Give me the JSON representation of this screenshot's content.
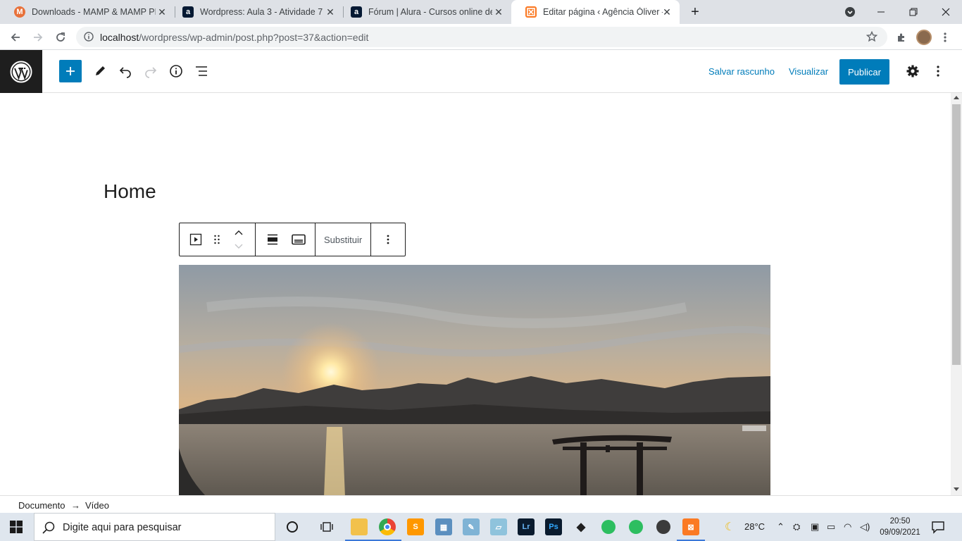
{
  "browser": {
    "tabs": [
      {
        "title": "Downloads - MAMP & MAMP PR",
        "favicon": "mamp-icon",
        "color": "#e8713a",
        "glyph": "M"
      },
      {
        "title": "Wordpress: Aula 3 - Atividade 7",
        "favicon": "alura-icon",
        "color": "#051933",
        "glyph": "a"
      },
      {
        "title": "Fórum | Alura - Cursos online de",
        "favicon": "alura-icon",
        "color": "#051933",
        "glyph": "a"
      },
      {
        "title": "Editar página ‹ Agência Óliver —",
        "favicon": "xampp-icon",
        "color": "#fb7a24",
        "glyph": "⊠"
      }
    ],
    "active_tab": 3,
    "url_host": "localhost",
    "url_path": "/wordpress/wp-admin/post.php?post=37&action=edit"
  },
  "wp": {
    "header": {
      "save_draft": "Salvar rascunho",
      "preview": "Visualizar",
      "publish": "Publicar"
    },
    "page_title": "Home",
    "block_toolbar": {
      "replace": "Substituir"
    },
    "breadcrumb": {
      "root": "Documento",
      "arrow": "→",
      "current": "Vídeo"
    },
    "accent": "#007cba"
  },
  "taskbar": {
    "search_placeholder": "Digite aqui para pesquisar",
    "weather": "28°C",
    "time": "20:50",
    "date": "09/09/2021"
  }
}
